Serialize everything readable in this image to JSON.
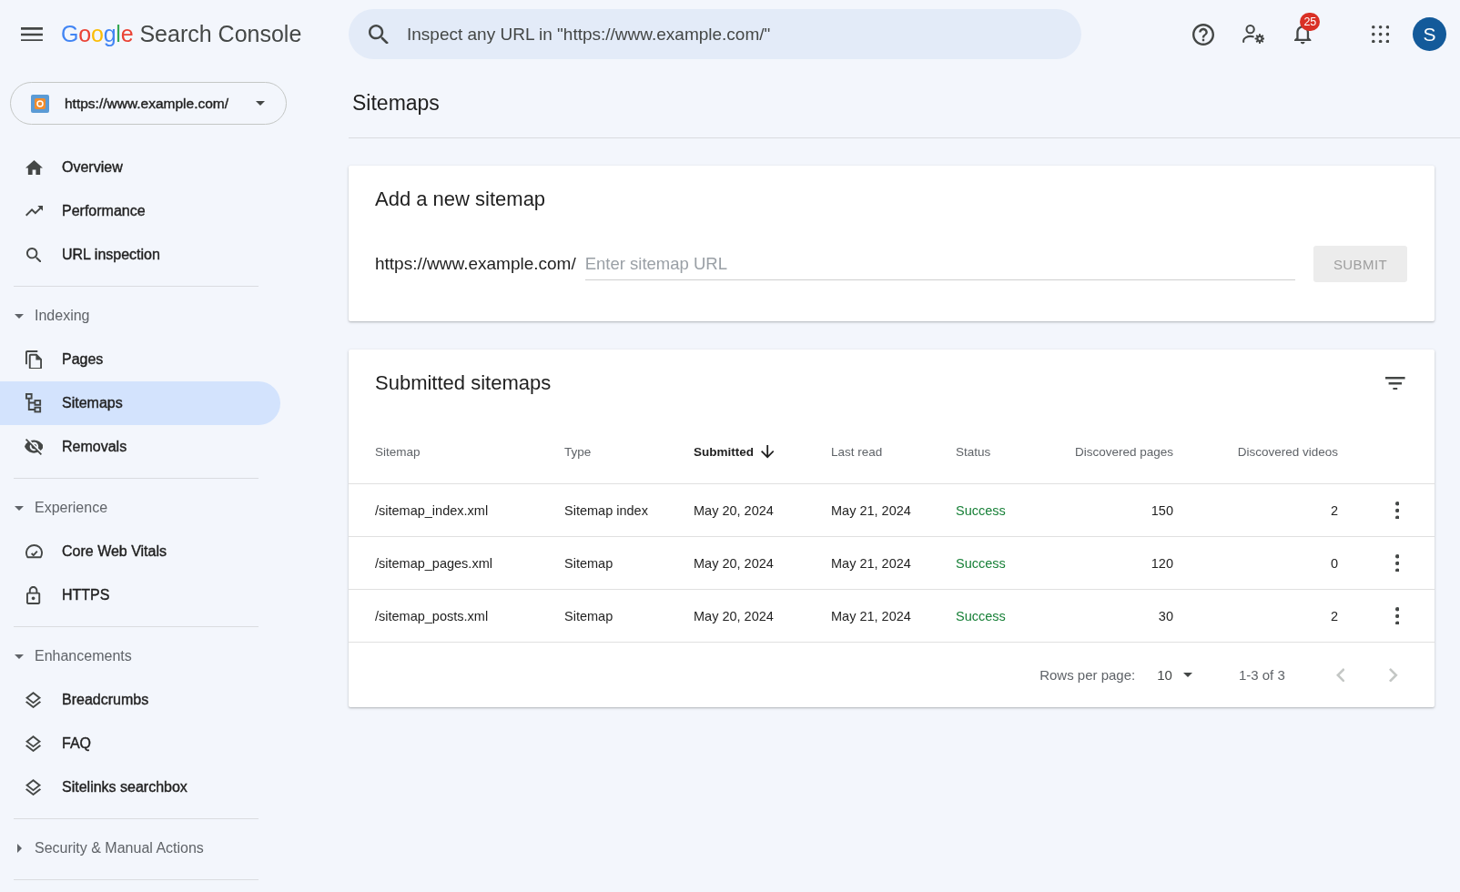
{
  "header": {
    "logo": "Google",
    "product": "Search Console",
    "search": {
      "placeholder": "Inspect any URL in \"https://www.example.com/\""
    },
    "notifications": {
      "count": "25"
    },
    "avatar": {
      "initial": "S"
    }
  },
  "property_selector": {
    "url": "https://www.example.com/"
  },
  "sidebar": {
    "sections": [
      {
        "items": [
          {
            "label": "Overview",
            "selected": false
          },
          {
            "label": "Performance",
            "selected": false
          },
          {
            "label": "URL inspection",
            "selected": false
          }
        ]
      },
      {
        "title": "Indexing",
        "expanded": true,
        "items": [
          {
            "label": "Pages",
            "selected": false
          },
          {
            "label": "Sitemaps",
            "selected": true
          },
          {
            "label": "Removals",
            "selected": false
          }
        ]
      },
      {
        "title": "Experience",
        "expanded": true,
        "items": [
          {
            "label": "Core Web Vitals",
            "selected": false
          },
          {
            "label": "HTTPS",
            "selected": false
          }
        ]
      },
      {
        "title": "Enhancements",
        "expanded": true,
        "items": [
          {
            "label": "Breadcrumbs",
            "selected": false
          },
          {
            "label": "FAQ",
            "selected": false
          },
          {
            "label": "Sitelinks searchbox",
            "selected": false
          }
        ]
      },
      {
        "title": "Security & Manual Actions",
        "expanded": false
      }
    ]
  },
  "page_title": "Sitemaps",
  "add_sitemap": {
    "title": "Add a new sitemap",
    "url_prefix": "https://www.example.com/",
    "input": {
      "placeholder": "Enter sitemap URL"
    },
    "submit": {
      "label": "SUBMIT",
      "disabled": true
    }
  },
  "submitted_sitemaps": {
    "title": "Submitted sitemaps",
    "table": {
      "columns": [
        {
          "label": "Sitemap",
          "sorted": false
        },
        {
          "label": "Type",
          "sorted": false
        },
        {
          "label": "Submitted",
          "sorted": true
        },
        {
          "label": "Last read",
          "sorted": false
        },
        {
          "label": "Status",
          "sorted": false
        },
        {
          "label": "Discovered pages",
          "sorted": false
        },
        {
          "label": "Discovered videos",
          "sorted": false
        }
      ],
      "rows": [
        {
          "cells": [
            "/sitemap_index.xml",
            "Sitemap index",
            "May 20, 2024",
            "May 21, 2024",
            "Success",
            "150",
            "2"
          ],
          "status_success": true
        },
        {
          "cells": [
            "/sitemap_pages.xml",
            "Sitemap",
            "May 20, 2024",
            "May 21, 2024",
            "Success",
            "120",
            "0"
          ],
          "status_success": true
        },
        {
          "cells": [
            "/sitemap_posts.xml",
            "Sitemap",
            "May 20, 2024",
            "May 21, 2024",
            "Success",
            "30",
            "2"
          ],
          "status_success": true
        }
      ]
    },
    "pagination": {
      "rows_per_page_label": "Rows per page:",
      "rows_per_page": "10",
      "range": "1-3 of 3",
      "previous_disabled": true,
      "next_disabled": true
    }
  }
}
